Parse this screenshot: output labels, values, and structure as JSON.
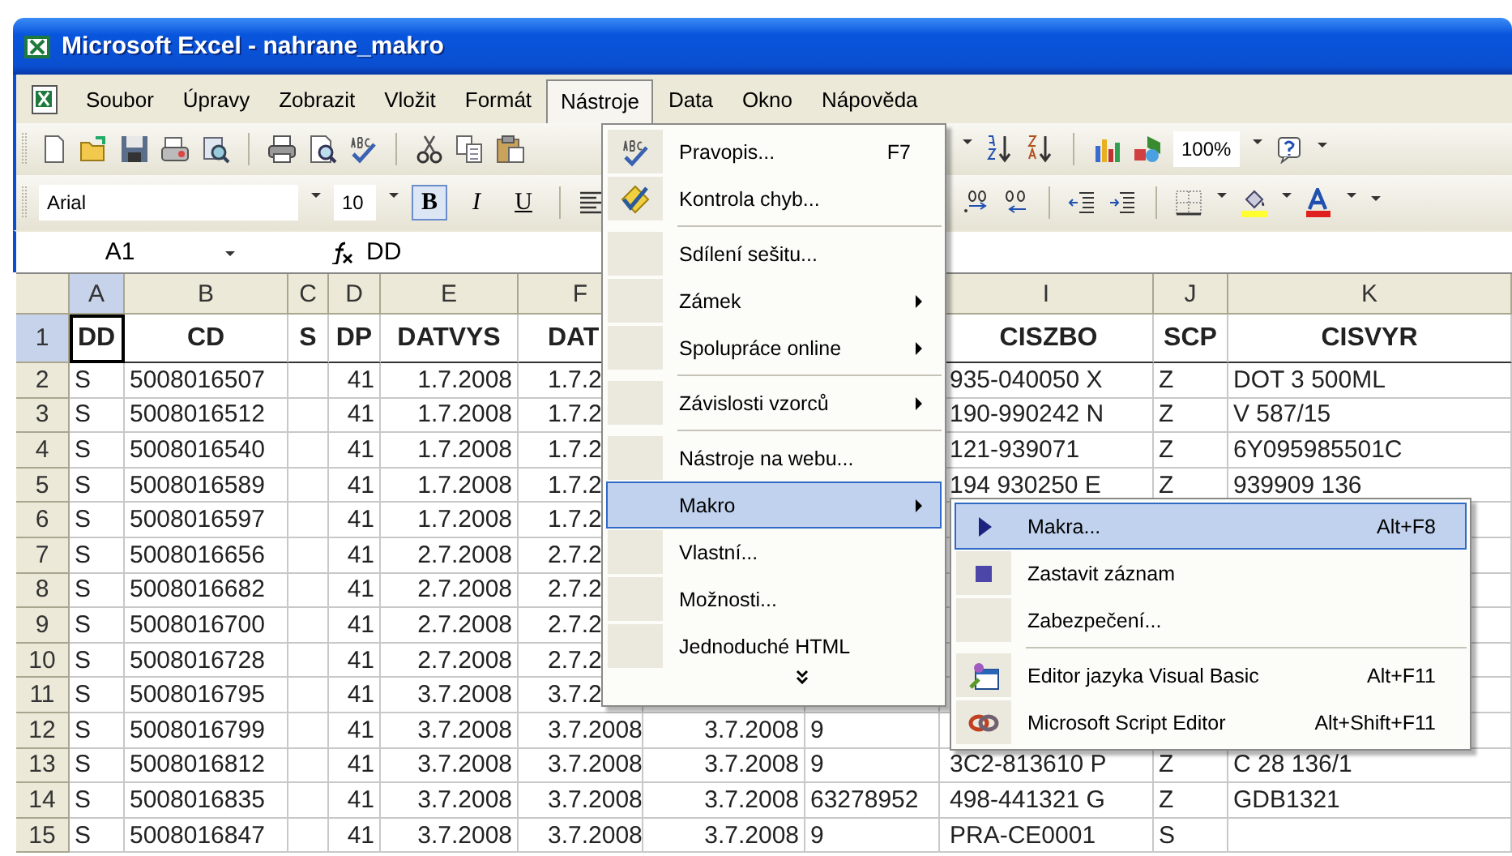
{
  "window": {
    "title": "Microsoft Excel - nahrane_makro"
  },
  "menu_bar": [
    {
      "label": "Soubor",
      "selected": false
    },
    {
      "label": "Úpravy",
      "selected": false
    },
    {
      "label": "Zobrazit",
      "selected": false
    },
    {
      "label": "Vložit",
      "selected": false
    },
    {
      "label": "Formát",
      "selected": false
    },
    {
      "label": "Nástroje",
      "selected": true
    },
    {
      "label": "Data",
      "selected": false
    },
    {
      "label": "Okno",
      "selected": false
    },
    {
      "label": "Nápověda",
      "selected": false
    }
  ],
  "standard_toolbar": {
    "zoom": "100%"
  },
  "formatting_toolbar": {
    "font": "Arial",
    "size": "10",
    "styles": [
      {
        "label": "B",
        "pressed": true
      },
      {
        "label": "I",
        "pressed": false
      },
      {
        "label": "U",
        "pressed": false
      }
    ]
  },
  "formula_bar": {
    "name_box": "A1",
    "formula": "DD"
  },
  "sheet": {
    "columns": [
      {
        "label": "A",
        "selected": true
      },
      {
        "label": "B",
        "selected": false
      },
      {
        "label": "C",
        "selected": false
      },
      {
        "label": "D",
        "selected": false
      },
      {
        "label": "E",
        "selected": false
      },
      {
        "label": "F",
        "selected": false
      },
      null,
      null,
      {
        "label": "I",
        "selected": false
      },
      {
        "label": "J",
        "selected": false
      },
      {
        "label": "K",
        "selected": false
      }
    ],
    "rows": [
      {
        "header": "1",
        "selected": true,
        "cells": [
          "DD",
          "CD",
          "S",
          "DP",
          "DATVYS",
          "DAT",
          null,
          null,
          "CISZBO",
          "SCP",
          "CISVYR"
        ]
      },
      {
        "header": "2",
        "selected": false,
        "cells": [
          "S",
          "5008016507",
          null,
          "41",
          "1.7.2008",
          "1.7.2",
          null,
          null,
          "935-040050 X",
          "Z",
          "DOT 3 500ML"
        ]
      },
      {
        "header": "3",
        "selected": false,
        "cells": [
          "S",
          "5008016512",
          null,
          "41",
          "1.7.2008",
          "1.7.2",
          null,
          null,
          "190-990242 N",
          "Z",
          "V 587/15"
        ]
      },
      {
        "header": "4",
        "selected": false,
        "cells": [
          "S",
          "5008016540",
          null,
          "41",
          "1.7.2008",
          "1.7.2",
          null,
          null,
          "121-939071",
          "Z",
          "6Y095985501C"
        ]
      },
      {
        "header": "5",
        "selected": false,
        "cells": [
          "S",
          "5008016589",
          null,
          "41",
          "1.7.2008",
          "1.7.2",
          null,
          null,
          "194 930250 E",
          "Z",
          "939909 136"
        ]
      },
      {
        "header": "6",
        "selected": false,
        "cells": [
          "S",
          "5008016597",
          null,
          "41",
          "1.7.2008",
          "1.7.2",
          null,
          null,
          null,
          null,
          null
        ]
      },
      {
        "header": "7",
        "selected": false,
        "cells": [
          "S",
          "5008016656",
          null,
          "41",
          "2.7.2008",
          "2.7.2",
          null,
          null,
          null,
          null,
          null
        ]
      },
      {
        "header": "8",
        "selected": false,
        "cells": [
          "S",
          "5008016682",
          null,
          "41",
          "2.7.2008",
          "2.7.2",
          null,
          null,
          null,
          null,
          null
        ]
      },
      {
        "header": "9",
        "selected": false,
        "cells": [
          "S",
          "5008016700",
          null,
          "41",
          "2.7.2008",
          "2.7.2",
          null,
          null,
          null,
          null,
          null
        ]
      },
      {
        "header": "10",
        "selected": false,
        "cells": [
          "S",
          "5008016728",
          null,
          "41",
          "2.7.2008",
          "2.7.2",
          null,
          null,
          null,
          null,
          null
        ]
      },
      {
        "header": "11",
        "selected": false,
        "cells": [
          "S",
          "5008016795",
          null,
          "41",
          "3.7.2008",
          "3.7.2",
          null,
          null,
          null,
          null,
          null
        ]
      },
      {
        "header": "12",
        "selected": false,
        "cells": [
          "S",
          "5008016799",
          null,
          "41",
          "3.7.2008",
          "3.7.2008",
          "3.7.2008",
          "9",
          null,
          null,
          null
        ]
      },
      {
        "header": "13",
        "selected": false,
        "cells": [
          "S",
          "5008016812",
          null,
          "41",
          "3.7.2008",
          "3.7.2008",
          "3.7.2008",
          "9",
          "3C2-813610 P",
          "Z",
          "C 28 136/1"
        ]
      },
      {
        "header": "14",
        "selected": false,
        "cells": [
          "S",
          "5008016835",
          null,
          "41",
          "3.7.2008",
          "3.7.2008",
          "3.7.2008",
          "63278952",
          "498-441321 G",
          "Z",
          "GDB1321"
        ]
      },
      {
        "header": "15",
        "selected": false,
        "cells": [
          "S",
          "5008016847",
          null,
          "41",
          "3.7.2008",
          "3.7.2008",
          "3.7.2008",
          "9",
          "PRA-CE0001",
          "S",
          null
        ]
      }
    ]
  },
  "tools_menu": {
    "items": [
      {
        "kind": "item",
        "label": "Pravopis...",
        "shortcut": "F7",
        "selected": false
      },
      {
        "kind": "item",
        "label": "Kontrola chyb...",
        "selected": false
      },
      {
        "kind": "separator"
      },
      {
        "kind": "item",
        "label": "Sdílení sešitu...",
        "selected": false
      },
      {
        "kind": "submenu",
        "label": "Zámek",
        "selected": false
      },
      {
        "kind": "submenu",
        "label": "Spolupráce online",
        "selected": false
      },
      {
        "kind": "separator"
      },
      {
        "kind": "submenu",
        "label": "Závislosti vzorců",
        "selected": false
      },
      {
        "kind": "separator"
      },
      {
        "kind": "item",
        "label": "Nástroje na webu...",
        "selected": false
      },
      {
        "kind": "submenu",
        "label": "Makro",
        "selected": true
      },
      {
        "kind": "item",
        "label": "Vlastní...",
        "selected": false
      },
      {
        "kind": "item",
        "label": "Možnosti...",
        "selected": false
      },
      {
        "kind": "item",
        "label": "Jednoduché HTML",
        "selected": false
      },
      {
        "kind": "expand"
      }
    ]
  },
  "macro_submenu": {
    "items": [
      {
        "kind": "item",
        "label": "Makra...",
        "shortcut": "Alt+F8",
        "selected": true
      },
      {
        "kind": "item",
        "label": "Zastavit záznam",
        "selected": false
      },
      {
        "kind": "item",
        "label": "Zabezpečení...",
        "selected": false
      },
      {
        "kind": "separator"
      },
      {
        "kind": "item",
        "label": "Editor jazyka Visual Basic",
        "shortcut": "Alt+F11",
        "selected": false
      },
      {
        "kind": "item",
        "label": "Microsoft Script Editor",
        "shortcut": "Alt+Shift+F11",
        "selected": false
      }
    ]
  }
}
